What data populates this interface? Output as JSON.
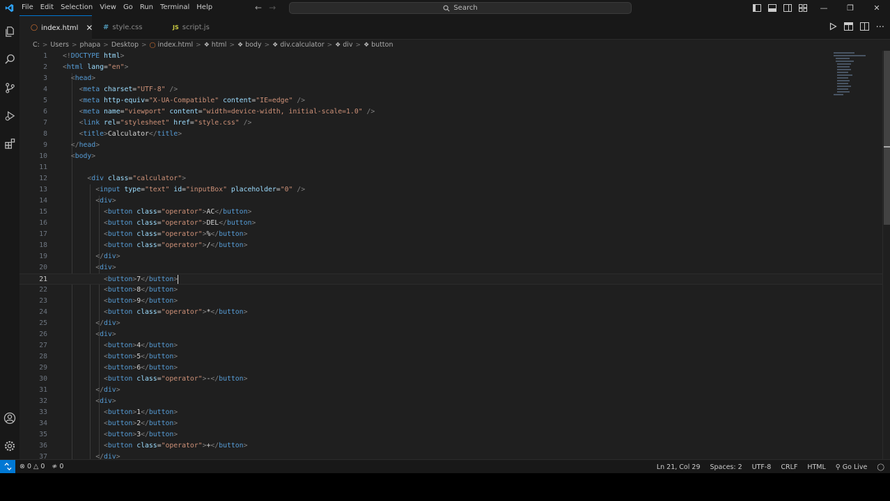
{
  "menu": [
    "File",
    "Edit",
    "Selection",
    "View",
    "Go",
    "Run",
    "Terminal",
    "Help"
  ],
  "search_placeholder": "Search",
  "tabs": [
    {
      "label": "index.html",
      "active": true,
      "color": "#e37933"
    },
    {
      "label": "style.css",
      "active": false,
      "color": "#519aba"
    },
    {
      "label": "script.js",
      "active": false,
      "color": "#cbcb41"
    }
  ],
  "breadcrumb": [
    "C:",
    "Users",
    "phapa",
    "Desktop",
    "index.html",
    "html",
    "body",
    "div.calculator",
    "div",
    "button"
  ],
  "editor": {
    "current_line": 21,
    "lines": [
      [
        [
          "t-p",
          "<!"
        ],
        [
          "t-tag",
          "DOCTYPE"
        ],
        [
          "t-text",
          " "
        ],
        [
          "t-attr",
          "html"
        ],
        [
          "t-p",
          ">"
        ]
      ],
      [
        [
          "t-p",
          "<"
        ],
        [
          "t-tag",
          "html"
        ],
        [
          "t-text",
          " "
        ],
        [
          "t-attr",
          "lang"
        ],
        [
          "t-text",
          "="
        ],
        [
          "t-str",
          "\"en\""
        ],
        [
          "t-p",
          ">"
        ]
      ],
      [
        [
          "t-text",
          "  "
        ],
        [
          "t-p",
          "<"
        ],
        [
          "t-tag",
          "head"
        ],
        [
          "t-p",
          ">"
        ]
      ],
      [
        [
          "t-text",
          "    "
        ],
        [
          "t-p",
          "<"
        ],
        [
          "t-tag",
          "meta"
        ],
        [
          "t-text",
          " "
        ],
        [
          "t-attr",
          "charset"
        ],
        [
          "t-text",
          "="
        ],
        [
          "t-str",
          "\"UTF-8\""
        ],
        [
          "t-text",
          " "
        ],
        [
          "t-p",
          "/>"
        ]
      ],
      [
        [
          "t-text",
          "    "
        ],
        [
          "t-p",
          "<"
        ],
        [
          "t-tag",
          "meta"
        ],
        [
          "t-text",
          " "
        ],
        [
          "t-attr",
          "http-equiv"
        ],
        [
          "t-text",
          "="
        ],
        [
          "t-str",
          "\"X-UA-Compatible\""
        ],
        [
          "t-text",
          " "
        ],
        [
          "t-attr",
          "content"
        ],
        [
          "t-text",
          "="
        ],
        [
          "t-str",
          "\"IE=edge\""
        ],
        [
          "t-text",
          " "
        ],
        [
          "t-p",
          "/>"
        ]
      ],
      [
        [
          "t-text",
          "    "
        ],
        [
          "t-p",
          "<"
        ],
        [
          "t-tag",
          "meta"
        ],
        [
          "t-text",
          " "
        ],
        [
          "t-attr",
          "name"
        ],
        [
          "t-text",
          "="
        ],
        [
          "t-str",
          "\"viewport\""
        ],
        [
          "t-text",
          " "
        ],
        [
          "t-attr",
          "content"
        ],
        [
          "t-text",
          "="
        ],
        [
          "t-str",
          "\"width=device-width, initial-scale=1.0\""
        ],
        [
          "t-text",
          " "
        ],
        [
          "t-p",
          "/>"
        ]
      ],
      [
        [
          "t-text",
          "    "
        ],
        [
          "t-p",
          "<"
        ],
        [
          "t-tag",
          "link"
        ],
        [
          "t-text",
          " "
        ],
        [
          "t-attr",
          "rel"
        ],
        [
          "t-text",
          "="
        ],
        [
          "t-str",
          "\"stylesheet\""
        ],
        [
          "t-text",
          " "
        ],
        [
          "t-attr",
          "href"
        ],
        [
          "t-text",
          "="
        ],
        [
          "t-str",
          "\"style.css\""
        ],
        [
          "t-text",
          " "
        ],
        [
          "t-p",
          "/>"
        ]
      ],
      [
        [
          "t-text",
          "    "
        ],
        [
          "t-p",
          "<"
        ],
        [
          "t-tag",
          "title"
        ],
        [
          "t-p",
          ">"
        ],
        [
          "t-text",
          "Calculator"
        ],
        [
          "t-p",
          "</"
        ],
        [
          "t-tag",
          "title"
        ],
        [
          "t-p",
          ">"
        ]
      ],
      [
        [
          "t-text",
          "  "
        ],
        [
          "t-p",
          "</"
        ],
        [
          "t-tag",
          "head"
        ],
        [
          "t-p",
          ">"
        ]
      ],
      [
        [
          "t-text",
          "  "
        ],
        [
          "t-p",
          "<"
        ],
        [
          "t-tag",
          "body"
        ],
        [
          "t-p",
          ">"
        ]
      ],
      [],
      [
        [
          "t-text",
          "      "
        ],
        [
          "t-p",
          "<"
        ],
        [
          "t-tag",
          "div"
        ],
        [
          "t-text",
          " "
        ],
        [
          "t-attr",
          "class"
        ],
        [
          "t-text",
          "="
        ],
        [
          "t-str",
          "\"calculator\""
        ],
        [
          "t-p",
          ">"
        ]
      ],
      [
        [
          "t-text",
          "        "
        ],
        [
          "t-p",
          "<"
        ],
        [
          "t-tag",
          "input"
        ],
        [
          "t-text",
          " "
        ],
        [
          "t-attr",
          "type"
        ],
        [
          "t-text",
          "="
        ],
        [
          "t-str",
          "\"text\""
        ],
        [
          "t-text",
          " "
        ],
        [
          "t-attr",
          "id"
        ],
        [
          "t-text",
          "="
        ],
        [
          "t-str",
          "\"inputBox\""
        ],
        [
          "t-text",
          " "
        ],
        [
          "t-attr",
          "placeholder"
        ],
        [
          "t-text",
          "="
        ],
        [
          "t-str",
          "\"0\""
        ],
        [
          "t-text",
          " "
        ],
        [
          "t-p",
          "/>"
        ]
      ],
      [
        [
          "t-text",
          "        "
        ],
        [
          "t-p",
          "<"
        ],
        [
          "t-tag",
          "div"
        ],
        [
          "t-p",
          ">"
        ]
      ],
      [
        [
          "t-text",
          "          "
        ],
        [
          "t-p",
          "<"
        ],
        [
          "t-tag",
          "button"
        ],
        [
          "t-text",
          " "
        ],
        [
          "t-attr",
          "class"
        ],
        [
          "t-text",
          "="
        ],
        [
          "t-str",
          "\"operator\""
        ],
        [
          "t-p",
          ">"
        ],
        [
          "t-text",
          "AC"
        ],
        [
          "t-p",
          "</"
        ],
        [
          "t-tag",
          "button"
        ],
        [
          "t-p",
          ">"
        ]
      ],
      [
        [
          "t-text",
          "          "
        ],
        [
          "t-p",
          "<"
        ],
        [
          "t-tag",
          "button"
        ],
        [
          "t-text",
          " "
        ],
        [
          "t-attr",
          "class"
        ],
        [
          "t-text",
          "="
        ],
        [
          "t-str",
          "\"operator\""
        ],
        [
          "t-p",
          ">"
        ],
        [
          "t-text",
          "DEL"
        ],
        [
          "t-p",
          "</"
        ],
        [
          "t-tag",
          "button"
        ],
        [
          "t-p",
          ">"
        ]
      ],
      [
        [
          "t-text",
          "          "
        ],
        [
          "t-p",
          "<"
        ],
        [
          "t-tag",
          "button"
        ],
        [
          "t-text",
          " "
        ],
        [
          "t-attr",
          "class"
        ],
        [
          "t-text",
          "="
        ],
        [
          "t-str",
          "\"operator\""
        ],
        [
          "t-p",
          ">"
        ],
        [
          "t-text",
          "%"
        ],
        [
          "t-p",
          "</"
        ],
        [
          "t-tag",
          "button"
        ],
        [
          "t-p",
          ">"
        ]
      ],
      [
        [
          "t-text",
          "          "
        ],
        [
          "t-p",
          "<"
        ],
        [
          "t-tag",
          "button"
        ],
        [
          "t-text",
          " "
        ],
        [
          "t-attr",
          "class"
        ],
        [
          "t-text",
          "="
        ],
        [
          "t-str",
          "\"operator\""
        ],
        [
          "t-p",
          ">"
        ],
        [
          "t-text",
          "/"
        ],
        [
          "t-p",
          "</"
        ],
        [
          "t-tag",
          "button"
        ],
        [
          "t-p",
          ">"
        ]
      ],
      [
        [
          "t-text",
          "        "
        ],
        [
          "t-p",
          "</"
        ],
        [
          "t-tag",
          "div"
        ],
        [
          "t-p",
          ">"
        ]
      ],
      [
        [
          "t-text",
          "        "
        ],
        [
          "t-p",
          "<"
        ],
        [
          "t-tag",
          "div"
        ],
        [
          "t-p",
          ">"
        ]
      ],
      [
        [
          "t-text",
          "          "
        ],
        [
          "t-p",
          "<"
        ],
        [
          "t-tag",
          "button"
        ],
        [
          "t-p",
          ">"
        ],
        [
          "t-text",
          "7"
        ],
        [
          "t-p",
          "</"
        ],
        [
          "t-tag",
          "button"
        ],
        [
          "t-p",
          ">"
        ]
      ],
      [
        [
          "t-text",
          "          "
        ],
        [
          "t-p",
          "<"
        ],
        [
          "t-tag",
          "button"
        ],
        [
          "t-p",
          ">"
        ],
        [
          "t-text",
          "8"
        ],
        [
          "t-p",
          "</"
        ],
        [
          "t-tag",
          "button"
        ],
        [
          "t-p",
          ">"
        ]
      ],
      [
        [
          "t-text",
          "          "
        ],
        [
          "t-p",
          "<"
        ],
        [
          "t-tag",
          "button"
        ],
        [
          "t-p",
          ">"
        ],
        [
          "t-text",
          "9"
        ],
        [
          "t-p",
          "</"
        ],
        [
          "t-tag",
          "button"
        ],
        [
          "t-p",
          ">"
        ]
      ],
      [
        [
          "t-text",
          "          "
        ],
        [
          "t-p",
          "<"
        ],
        [
          "t-tag",
          "button"
        ],
        [
          "t-text",
          " "
        ],
        [
          "t-attr",
          "class"
        ],
        [
          "t-text",
          "="
        ],
        [
          "t-str",
          "\"operator\""
        ],
        [
          "t-p",
          ">"
        ],
        [
          "t-text",
          "*"
        ],
        [
          "t-p",
          "</"
        ],
        [
          "t-tag",
          "button"
        ],
        [
          "t-p",
          ">"
        ]
      ],
      [
        [
          "t-text",
          "        "
        ],
        [
          "t-p",
          "</"
        ],
        [
          "t-tag",
          "div"
        ],
        [
          "t-p",
          ">"
        ]
      ],
      [
        [
          "t-text",
          "        "
        ],
        [
          "t-p",
          "<"
        ],
        [
          "t-tag",
          "div"
        ],
        [
          "t-p",
          ">"
        ]
      ],
      [
        [
          "t-text",
          "          "
        ],
        [
          "t-p",
          "<"
        ],
        [
          "t-tag",
          "button"
        ],
        [
          "t-p",
          ">"
        ],
        [
          "t-text",
          "4"
        ],
        [
          "t-p",
          "</"
        ],
        [
          "t-tag",
          "button"
        ],
        [
          "t-p",
          ">"
        ]
      ],
      [
        [
          "t-text",
          "          "
        ],
        [
          "t-p",
          "<"
        ],
        [
          "t-tag",
          "button"
        ],
        [
          "t-p",
          ">"
        ],
        [
          "t-text",
          "5"
        ],
        [
          "t-p",
          "</"
        ],
        [
          "t-tag",
          "button"
        ],
        [
          "t-p",
          ">"
        ]
      ],
      [
        [
          "t-text",
          "          "
        ],
        [
          "t-p",
          "<"
        ],
        [
          "t-tag",
          "button"
        ],
        [
          "t-p",
          ">"
        ],
        [
          "t-text",
          "6"
        ],
        [
          "t-p",
          "</"
        ],
        [
          "t-tag",
          "button"
        ],
        [
          "t-p",
          ">"
        ]
      ],
      [
        [
          "t-text",
          "          "
        ],
        [
          "t-p",
          "<"
        ],
        [
          "t-tag",
          "button"
        ],
        [
          "t-text",
          " "
        ],
        [
          "t-attr",
          "class"
        ],
        [
          "t-text",
          "="
        ],
        [
          "t-str",
          "\"operator\""
        ],
        [
          "t-p",
          ">"
        ],
        [
          "t-text",
          "-"
        ],
        [
          "t-p",
          "</"
        ],
        [
          "t-tag",
          "button"
        ],
        [
          "t-p",
          ">"
        ]
      ],
      [
        [
          "t-text",
          "        "
        ],
        [
          "t-p",
          "</"
        ],
        [
          "t-tag",
          "div"
        ],
        [
          "t-p",
          ">"
        ]
      ],
      [
        [
          "t-text",
          "        "
        ],
        [
          "t-p",
          "<"
        ],
        [
          "t-tag",
          "div"
        ],
        [
          "t-p",
          ">"
        ]
      ],
      [
        [
          "t-text",
          "          "
        ],
        [
          "t-p",
          "<"
        ],
        [
          "t-tag",
          "button"
        ],
        [
          "t-p",
          ">"
        ],
        [
          "t-text",
          "1"
        ],
        [
          "t-p",
          "</"
        ],
        [
          "t-tag",
          "button"
        ],
        [
          "t-p",
          ">"
        ]
      ],
      [
        [
          "t-text",
          "          "
        ],
        [
          "t-p",
          "<"
        ],
        [
          "t-tag",
          "button"
        ],
        [
          "t-p",
          ">"
        ],
        [
          "t-text",
          "2"
        ],
        [
          "t-p",
          "</"
        ],
        [
          "t-tag",
          "button"
        ],
        [
          "t-p",
          ">"
        ]
      ],
      [
        [
          "t-text",
          "          "
        ],
        [
          "t-p",
          "<"
        ],
        [
          "t-tag",
          "button"
        ],
        [
          "t-p",
          ">"
        ],
        [
          "t-text",
          "3"
        ],
        [
          "t-p",
          "</"
        ],
        [
          "t-tag",
          "button"
        ],
        [
          "t-p",
          ">"
        ]
      ],
      [
        [
          "t-text",
          "          "
        ],
        [
          "t-p",
          "<"
        ],
        [
          "t-tag",
          "button"
        ],
        [
          "t-text",
          " "
        ],
        [
          "t-attr",
          "class"
        ],
        [
          "t-text",
          "="
        ],
        [
          "t-str",
          "\"operator\""
        ],
        [
          "t-p",
          ">"
        ],
        [
          "t-text",
          "+"
        ],
        [
          "t-p",
          "</"
        ],
        [
          "t-tag",
          "button"
        ],
        [
          "t-p",
          ">"
        ]
      ],
      [
        [
          "t-text",
          "        "
        ],
        [
          "t-p",
          "</"
        ],
        [
          "t-tag",
          "div"
        ],
        [
          "t-p",
          ">"
        ]
      ]
    ]
  },
  "status": {
    "errors": "0",
    "warnings": "0",
    "ports": "0",
    "position": "Ln 21, Col 29",
    "spaces": "Spaces: 2",
    "encoding": "UTF-8",
    "eol": "CRLF",
    "language": "HTML",
    "go_live": "Go Live"
  },
  "colors": {
    "accent": "#0078d4",
    "html_icon": "#e37933",
    "css_icon": "#519aba",
    "js_icon": "#cbcb41"
  }
}
